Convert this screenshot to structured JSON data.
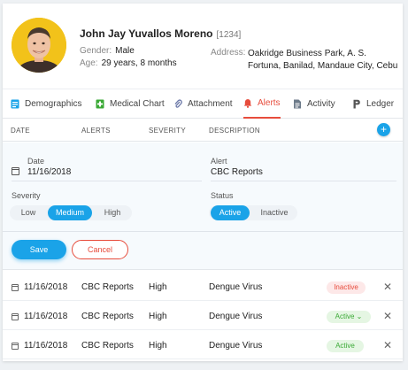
{
  "patient": {
    "name": "John Jay Yuvallos Moreno",
    "id": "[1234]",
    "gender_label": "Gender:",
    "gender": "Male",
    "age_label": "Age:",
    "age": "29 years, 8 months",
    "address_label": "Address:",
    "address": "Oakridge Business Park, A. S. Fortuna, Banilad, Mandaue City, Cebu"
  },
  "tabs": [
    {
      "label": "Demographics",
      "icon": "id-card-icon",
      "active": false
    },
    {
      "label": "Medical Chart",
      "icon": "medical-book-icon",
      "active": false
    },
    {
      "label": "Attachment",
      "icon": "paperclip-icon",
      "active": false
    },
    {
      "label": "Alerts",
      "icon": "bell-icon",
      "active": true
    },
    {
      "label": "Activity",
      "icon": "document-icon",
      "active": false
    },
    {
      "label": "Ledger",
      "icon": "p-icon",
      "active": false
    }
  ],
  "table": {
    "headers": [
      "DATE",
      "ALERTS",
      "SEVERITY",
      "DESCRIPTION"
    ],
    "add_label": "+"
  },
  "form": {
    "date_label": "Date",
    "date_value": "11/16/2018",
    "alert_label": "Alert",
    "alert_value": "CBC Reports",
    "severity_label": "Severity",
    "severity_options": [
      "Low",
      "Medium",
      "High"
    ],
    "severity_selected": "Medium",
    "status_label": "Status",
    "status_options": [
      "Active",
      "Inactive"
    ],
    "status_selected": "Active",
    "save_label": "Save",
    "cancel_label": "Cancel"
  },
  "rows": [
    {
      "date": "11/16/2018",
      "alert": "CBC Reports",
      "severity": "High",
      "description": "Dengue Virus",
      "status": "Inactive"
    },
    {
      "date": "11/16/2018",
      "alert": "CBC Reports",
      "severity": "High",
      "description": "Dengue Virus",
      "status": "Active ⌄"
    },
    {
      "date": "11/16/2018",
      "alert": "CBC Reports",
      "severity": "High",
      "description": "Dengue Virus",
      "status": "Active"
    }
  ],
  "colors": {
    "accent": "#1aa3e8",
    "active_tab": "#e74c3c",
    "active_badge": "#3aa935",
    "inactive_badge": "#e74c3c"
  }
}
